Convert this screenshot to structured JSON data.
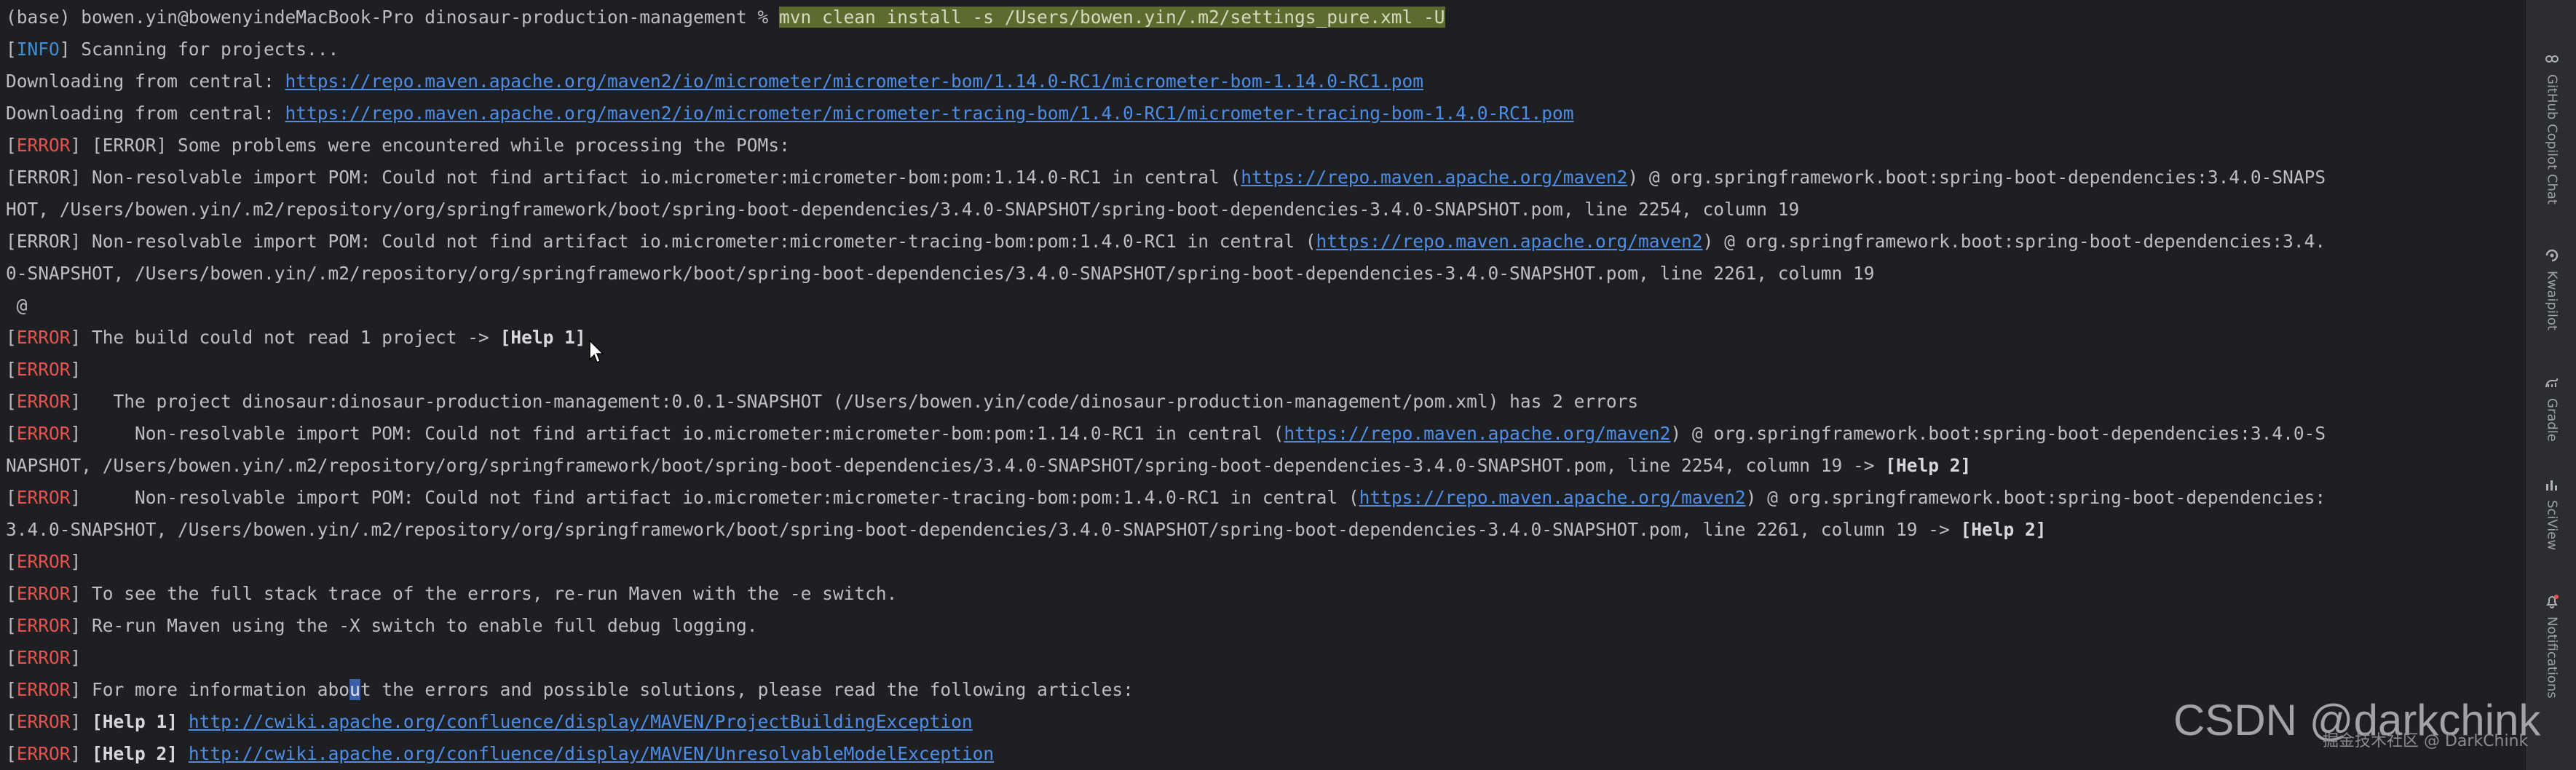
{
  "terminal": {
    "prompt": "(base) bowen.yin@bowenyindeMacBook-Pro dinosaur-production-management % ",
    "command": "mvn clean install -s /Users/bowen.yin/.m2/settings_pure.xml -U",
    "tags": {
      "info": "INFO",
      "error": "ERROR",
      "help1": "[Help 1]",
      "help2": "[Help 2]"
    },
    "lines": {
      "scanning": " Scanning for projects...",
      "download_prefix": "Downloading from central: ",
      "download1_url": "https://repo.maven.apache.org/maven2/io/micrometer/micrometer-bom/1.14.0-RC1/micrometer-bom-1.14.0-RC1.pom",
      "download2_url": "https://repo.maven.apache.org/maven2/io/micrometer/micrometer-tracing-bom/1.4.0-RC1/micrometer-tracing-bom-1.4.0-RC1.pom",
      "problems": " [ERROR] Some problems were encountered while processing the POMs:",
      "err1_a": " Non-resolvable import POM: Could not find artifact io.micrometer:micrometer-bom:pom:1.14.0-RC1 in central (",
      "repo_url": "https://repo.maven.apache.org/maven2",
      "err1_b": ") @ org.springframework.boot:spring-boot-dependencies:3.4.0-SNAPS",
      "err1_c": "HOT, /Users/bowen.yin/.m2/repository/org/springframework/boot/spring-boot-dependencies/3.4.0-SNAPSHOT/spring-boot-dependencies-3.4.0-SNAPSHOT.pom, line 2254, column 19",
      "err2_a": " Non-resolvable import POM: Could not find artifact io.micrometer:micrometer-tracing-bom:pom:1.4.0-RC1 in central (",
      "err2_b": ") @ org.springframework.boot:spring-boot-dependencies:3.4.",
      "err2_c": "0-SNAPSHOT, /Users/bowen.yin/.m2/repository/org/springframework/boot/spring-boot-dependencies/3.4.0-SNAPSHOT/spring-boot-dependencies-3.4.0-SNAPSHOT.pom, line 2261, column 19",
      "at": " @",
      "build": " The build could not read 1 project -> ",
      "project": "   The project dinosaur:dinosaur-production-management:0.0.1-SNAPSHOT (/Users/bowen.yin/code/dinosaur-production-management/pom.xml) has 2 errors",
      "err3_a": "     Non-resolvable import POM: Could not find artifact io.micrometer:micrometer-bom:pom:1.14.0-RC1 in central (",
      "err3_b": ") @ org.springframework.boot:spring-boot-dependencies:3.4.0-S",
      "err3_c": "NAPSHOT, /Users/bowen.yin/.m2/repository/org/springframework/boot/spring-boot-dependencies/3.4.0-SNAPSHOT/spring-boot-dependencies-3.4.0-SNAPSHOT.pom, line 2254, column 19 -> ",
      "err4_a": "     Non-resolvable import POM: Could not find artifact io.micrometer:micrometer-tracing-bom:pom:1.4.0-RC1 in central (",
      "err4_b": ") @ org.springframework.boot:spring-boot-dependencies:",
      "err4_c": "3.4.0-SNAPSHOT, /Users/bowen.yin/.m2/repository/org/springframework/boot/spring-boot-dependencies/3.4.0-SNAPSHOT/spring-boot-dependencies-3.4.0-SNAPSHOT.pom, line 2261, column 19 -> ",
      "stack": " To see the full stack trace of the errors, re-run Maven with the -e switch.",
      "debug": " Re-run Maven using the -X switch to enable full debug logging.",
      "more_a": " For more information abo",
      "more_cursor": "u",
      "more_b": "t the errors and possible solutions, please read the following articles:",
      "help1_url": "http://cwiki.apache.org/confluence/display/MAVEN/ProjectBuildingException",
      "help2_url": "http://cwiki.apache.org/confluence/display/MAVEN/UnresolvableModelException"
    }
  },
  "right_toolbar": {
    "items": [
      {
        "label": "GitHub Copilot Chat",
        "icon": "copilot-icon"
      },
      {
        "label": "Kwaipilot",
        "icon": "kwaipilot-icon"
      },
      {
        "label": "Gradle",
        "icon": "gradle-icon"
      },
      {
        "label": "SciView",
        "icon": "sciview-icon"
      },
      {
        "label": "Notifications",
        "icon": "bell-icon"
      }
    ]
  },
  "watermark": {
    "small": "掘金技术社区 @ DarkChink",
    "big": "CSDN @darkchink"
  },
  "colors": {
    "background": "#1e1f22",
    "text": "#bcbec4",
    "info": "#3d8fd6",
    "error": "#e8524a",
    "link": "#4d8ee8",
    "command_highlight": "#5e6b2e"
  }
}
